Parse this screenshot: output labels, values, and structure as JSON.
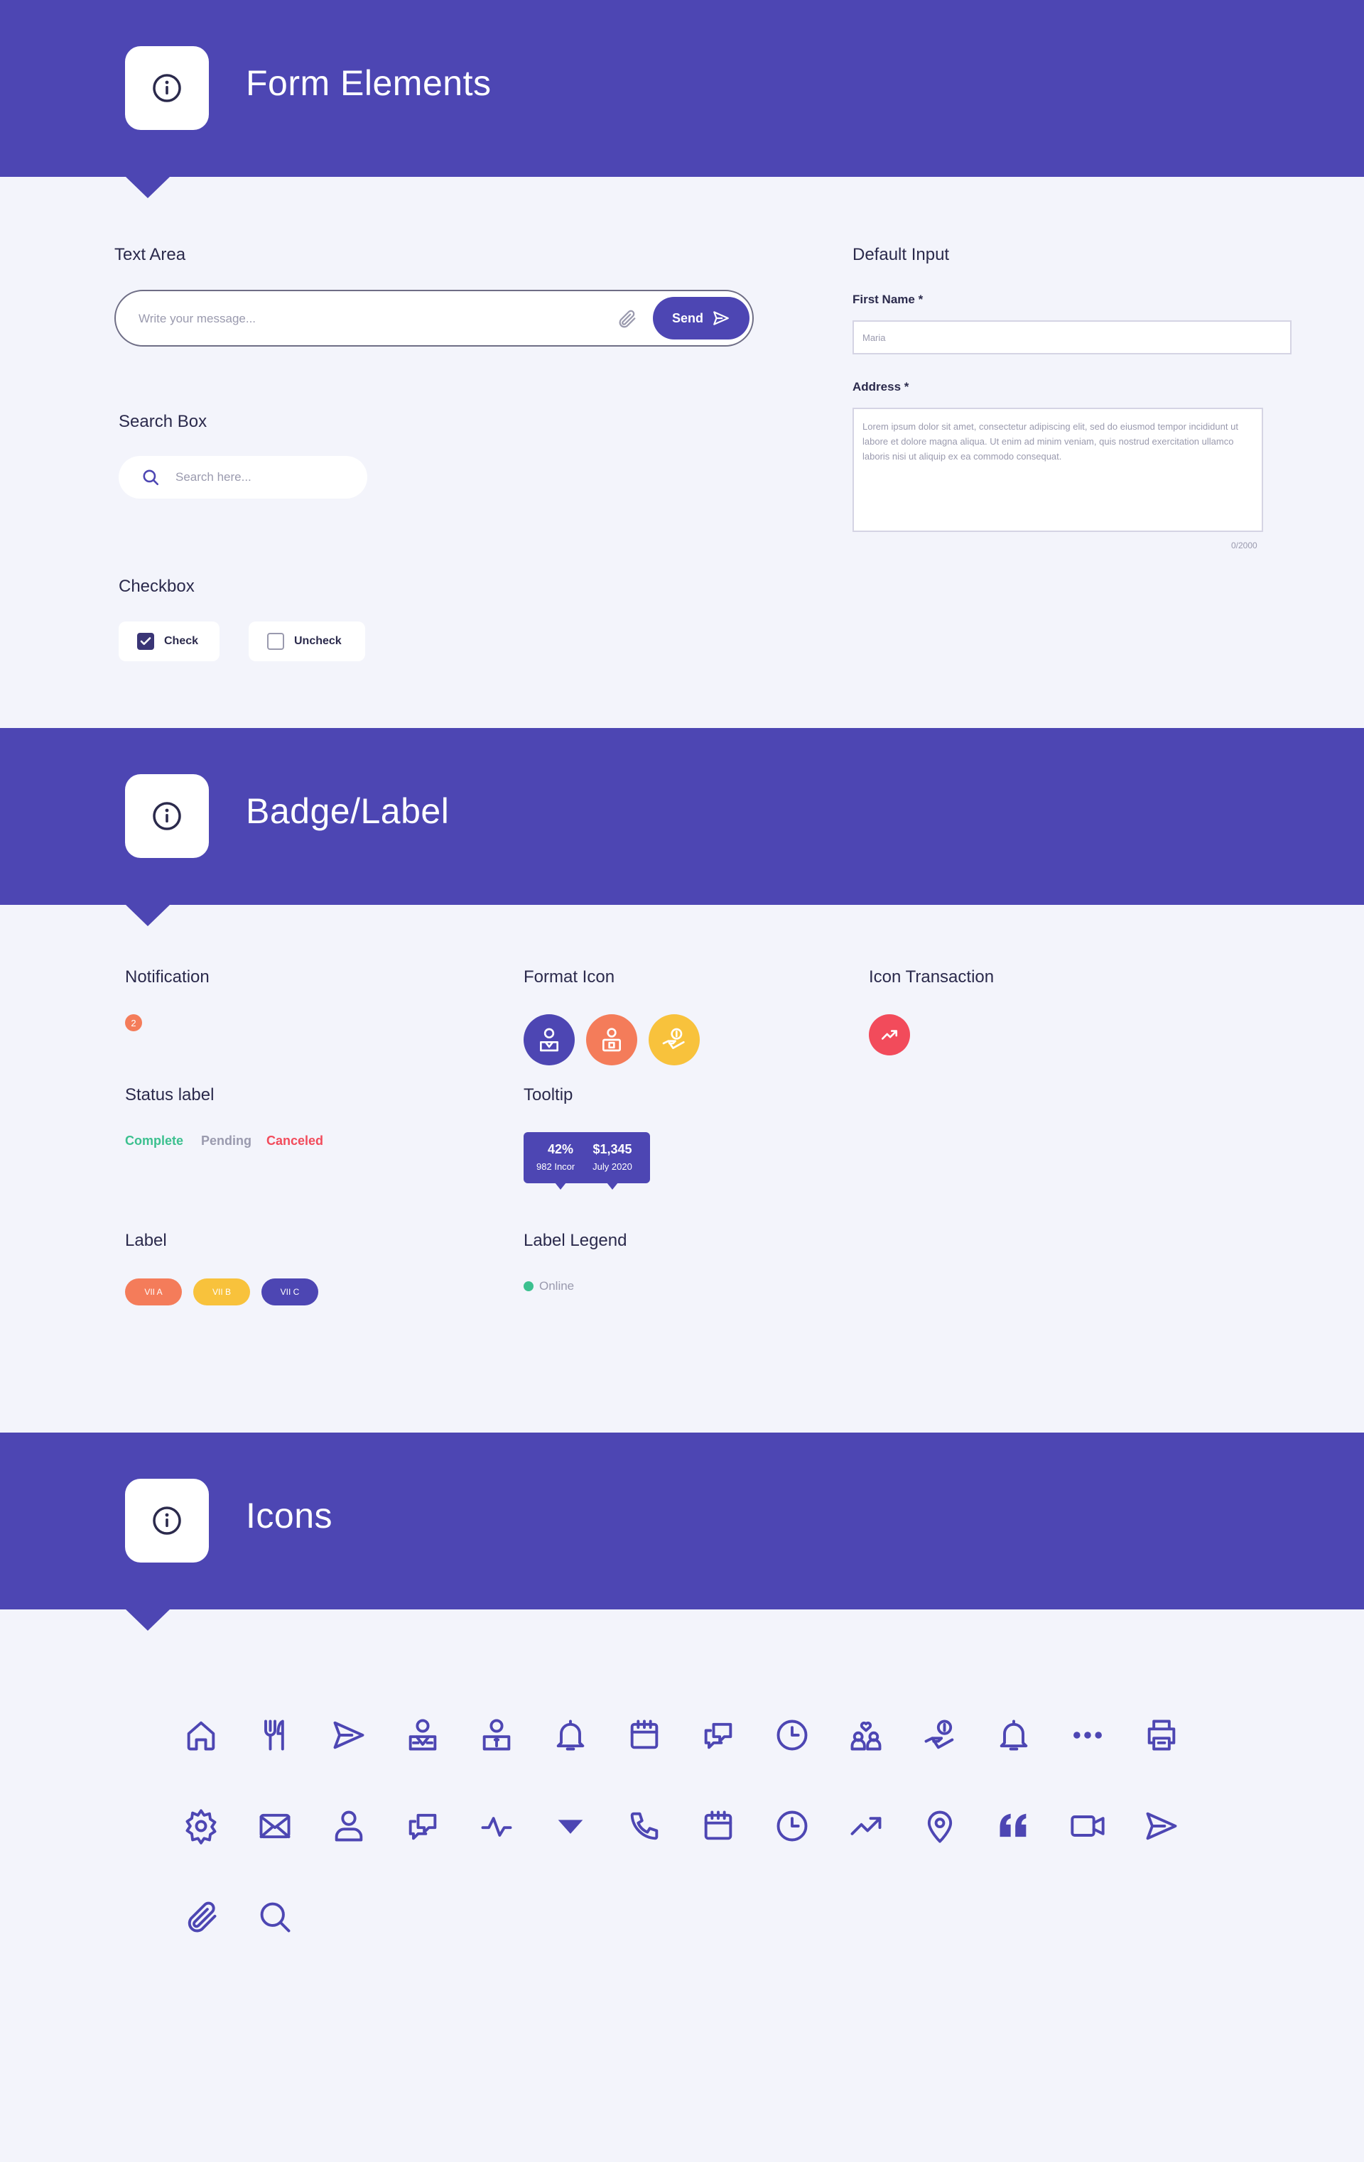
{
  "colors": {
    "primary": "#4D46B3",
    "background": "#F3F4FB",
    "orange": "#F47C5A",
    "yellow": "#F8C23C",
    "red": "#F24B5B",
    "green": "#3CC08F",
    "gray": "#9A9AAE"
  },
  "sections": {
    "form": {
      "title": "Form Elements"
    },
    "badge": {
      "title": "Badge/Label"
    },
    "icons": {
      "title": "Icons"
    }
  },
  "form": {
    "text_area": {
      "label": "Text Area",
      "placeholder": "Write your message...",
      "send_label": "Send"
    },
    "search_box": {
      "label": "Search Box",
      "placeholder": "Search here..."
    },
    "checkbox": {
      "label": "Checkbox",
      "checked_label": "Check",
      "unchecked_label": "Uncheck"
    },
    "default_input": {
      "label": "Default Input",
      "first_name_label": "First Name *",
      "first_name_value": "Maria",
      "address_label": "Address *",
      "address_value": "Lorem ipsum dolor sit amet, consectetur adipiscing elit, sed do eiusmod tempor incididunt ut labore et dolore magna aliqua. Ut enim ad minim veniam, quis nostrud exercitation ullamco laboris nisi ut aliquip ex ea commodo consequat.",
      "counter": "0/2000"
    }
  },
  "badge": {
    "notification": {
      "label": "Notification",
      "count": "2"
    },
    "format_icon": {
      "label": "Format Icon",
      "icons": [
        "user-badge-icon",
        "user-card-icon",
        "dollar-hand-icon"
      ]
    },
    "icon_transaction": {
      "label": "Icon Transaction",
      "icon": "trending-up-icon"
    },
    "status_label": {
      "label": "Status label",
      "complete": "Complete",
      "pending": "Pending",
      "canceled": "Canceled"
    },
    "tooltip": {
      "label": "Tooltip",
      "items": [
        {
          "value": "42%",
          "sub": "982 Income"
        },
        {
          "value": "$1,345",
          "sub": "July 2020"
        }
      ]
    },
    "label": {
      "label": "Label",
      "pills": [
        "VII A",
        "VII B",
        "VII C"
      ]
    },
    "label_legend": {
      "label": "Label Legend",
      "text": "Online"
    }
  },
  "icons": {
    "row1": [
      "home-icon",
      "fork-icon",
      "send-icon",
      "employee-icon",
      "manager-icon",
      "bell-icon",
      "calendar-icon",
      "chat-icon",
      "clock-icon",
      "family-icon",
      "payment-hand-icon",
      "bell-icon",
      "more-dots-icon",
      "printer-icon"
    ],
    "row2": [
      "settings-icon",
      "mail-icon",
      "user-icon",
      "chat-icon",
      "activity-icon",
      "caret-down-icon",
      "phone-icon",
      "calendar-icon",
      "clock-icon",
      "trending-up-icon",
      "location-pin-icon",
      "quote-icon",
      "video-icon",
      "send-icon"
    ],
    "row3": [
      "paperclip-icon",
      "search-icon"
    ]
  }
}
